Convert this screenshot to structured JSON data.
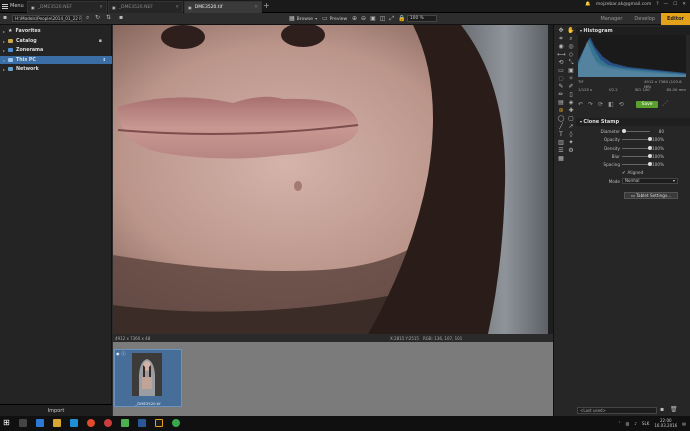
{
  "titlebar": {
    "menu_label": "Menu",
    "tabs": [
      {
        "label": "_DME3520.NEF",
        "active": false
      },
      {
        "label": "_DME3520.NEF",
        "active": false
      },
      {
        "label": "DME3520.tif",
        "active": true
      }
    ],
    "new_tab": "+",
    "email": "mojzebar.ak@gmail.com"
  },
  "toolbar": {
    "path": "H:\\Models\\People\\2014_01_22 Ro...\\Export",
    "browse_label": "Browse",
    "preview_label": "Preview",
    "zoom_value": "100 %"
  },
  "modes": [
    {
      "label": "Manager",
      "active": false
    },
    {
      "label": "Develop",
      "active": false
    },
    {
      "label": "Editor",
      "active": true
    }
  ],
  "sidebar": {
    "items": [
      {
        "label": "Favorites"
      },
      {
        "label": "Catalog"
      },
      {
        "label": "Zonerama"
      },
      {
        "label": "This PC",
        "selected": true
      },
      {
        "label": "Network"
      }
    ],
    "import_label": "Import"
  },
  "status": {
    "dimensions": "4912 x 7360 x 48",
    "coords": "X:2815 Y:2515",
    "rgb": "RGB: 136, 107, 101"
  },
  "filmstrip": {
    "thumb_label": "_DME3520.tif"
  },
  "histogram": {
    "title": "Histogram",
    "meta_left": "TIF",
    "meta_right": "4912 x 7360 (103.6 MB)",
    "exposure": "1/125 s",
    "aperture": "f/2.2",
    "iso": "ISO 100",
    "focal": "85.00 mm"
  },
  "actions": {
    "save_label": "Save"
  },
  "clone_stamp": {
    "title": "Clone Stamp",
    "sliders": [
      {
        "label": "Diameter",
        "value": "80",
        "fraction": 0.0
      },
      {
        "label": "Opacity",
        "value": "100%",
        "fraction": 1.0
      },
      {
        "label": "Density",
        "value": "100%",
        "fraction": 1.0
      },
      {
        "label": "Blur",
        "value": "100%",
        "fraction": 1.0
      },
      {
        "label": "Spacing",
        "value": "100%",
        "fraction": 1.0
      }
    ],
    "aligned_label": "Aligned",
    "mode_label": "Mode",
    "mode_value": "Normal",
    "tablet_settings_label": "Tablet Settings..."
  },
  "presets": {
    "placeholder": "<Last used>"
  },
  "taskbar": {
    "language": "SLK",
    "time": "22:00",
    "date": "16.03.2016"
  },
  "colors": {
    "accent": "#e4a21a",
    "save": "#5aa02c",
    "selection": "#3a6ea5"
  }
}
